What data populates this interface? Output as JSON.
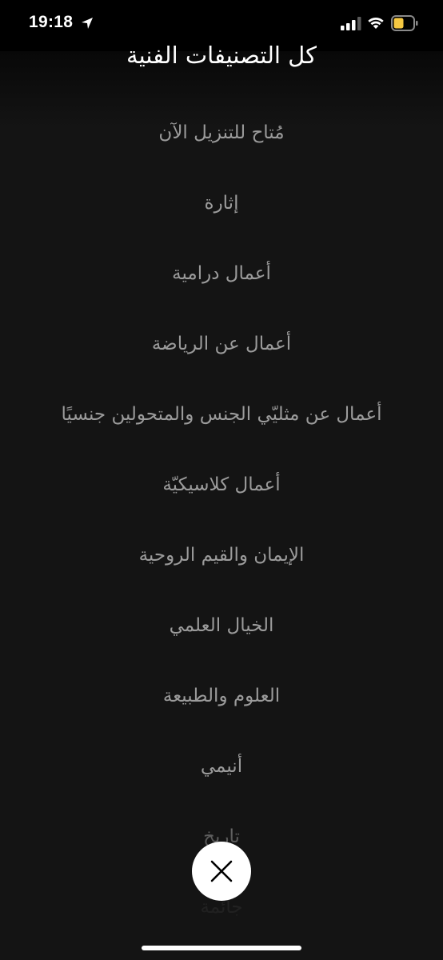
{
  "status_bar": {
    "time": "19:18"
  },
  "header": {
    "title": "كل التصنيفات الفنية"
  },
  "categories": [
    "مُتاح للتنزيل الآن",
    "إثارة",
    "أعمال درامية",
    "أعمال عن الرياضة",
    "أعمال عن مثليّي الجنس والمتحولين جنسيًا",
    "أعمال كلاسيكيّة",
    "الإيمان والقيم الروحية",
    "الخيال العلمي",
    "العلوم والطبيعة",
    "أنيمي",
    "تاريخ",
    "جائمة"
  ],
  "colors": {
    "background": "#141414",
    "item_text": "#9b9b9b",
    "battery_fill": "#f5c842"
  },
  "icons": {
    "close": "close-icon"
  }
}
